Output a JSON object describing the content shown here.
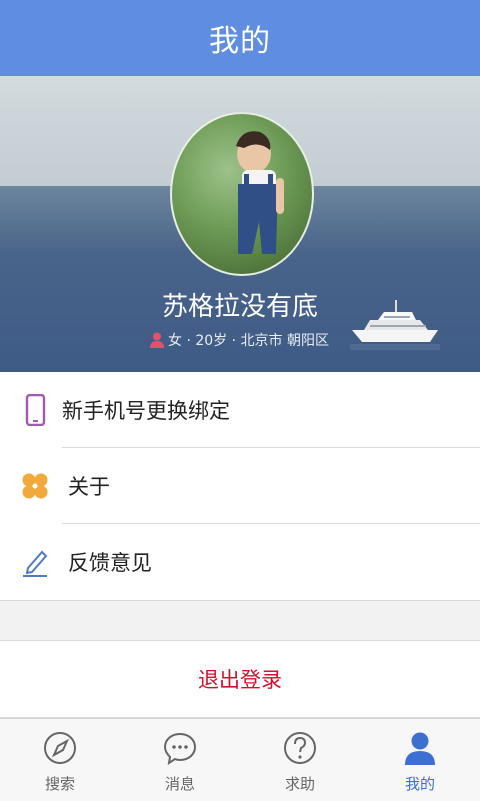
{
  "header": {
    "title": "我的"
  },
  "profile": {
    "name": "苏格拉没有底",
    "meta": "女 · 20岁 · 北京市 朝阳区"
  },
  "menu": {
    "items": [
      {
        "label": "新手机号更换绑定",
        "icon": "phone-icon"
      },
      {
        "label": "关于",
        "icon": "four-petal-icon"
      },
      {
        "label": "反馈意见",
        "icon": "pencil-icon"
      }
    ]
  },
  "logout": {
    "label": "退出登录"
  },
  "tabbar": {
    "tabs": [
      {
        "label": "搜索",
        "icon": "compass-icon"
      },
      {
        "label": "消息",
        "icon": "chat-icon"
      },
      {
        "label": "求助",
        "icon": "help-icon"
      },
      {
        "label": "我的",
        "icon": "user-icon",
        "active": true
      }
    ]
  },
  "colors": {
    "primary": "#5f8de0",
    "active_tab": "#3d6fd0",
    "logout": "#d0112b"
  }
}
